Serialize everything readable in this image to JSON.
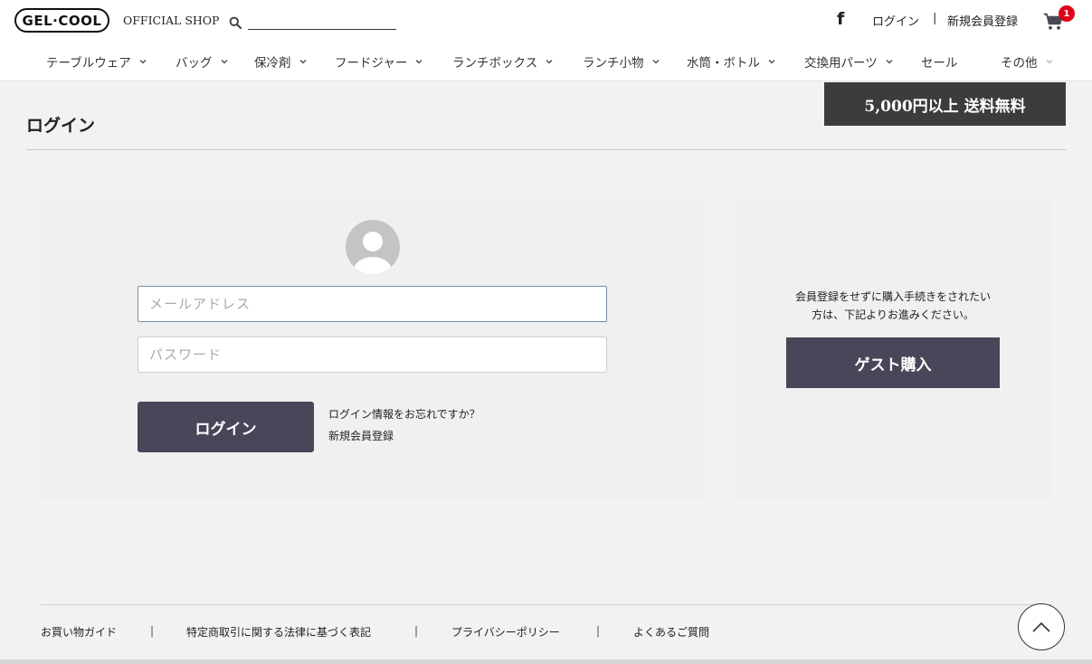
{
  "header": {
    "logo_text": "GEL·COOL",
    "shop_label": "OFFICIAL SHOP",
    "search_value": "",
    "login_link": "ログイン",
    "separator": "|",
    "register_link": "新規会員登録",
    "cart_count": "1",
    "icons": {
      "search": "search-icon",
      "facebook": "facebook-icon",
      "cart": "cart-icon"
    },
    "badge_color": "#e1001a"
  },
  "nav": {
    "items": [
      {
        "label": "テーブルウェア",
        "has_dropdown": true
      },
      {
        "label": "バッグ",
        "has_dropdown": true
      },
      {
        "label": "保冷剤",
        "has_dropdown": true
      },
      {
        "label": "フードジャー",
        "has_dropdown": true
      },
      {
        "label": "ランチボックス",
        "has_dropdown": true
      },
      {
        "label": "ランチ小物",
        "has_dropdown": true
      },
      {
        "label": "水筒・ボトル",
        "has_dropdown": true
      },
      {
        "label": "交換用パーツ",
        "has_dropdown": true
      },
      {
        "label": "セール",
        "has_dropdown": false
      },
      {
        "label": "その他",
        "has_dropdown": true
      }
    ]
  },
  "promo": {
    "text": "5,000円以上 送料無料"
  },
  "page": {
    "title": "ログイン"
  },
  "login": {
    "email_placeholder": "メールアドレス",
    "email_value": "",
    "password_placeholder": "パスワード",
    "password_value": "",
    "submit_label": "ログイン",
    "forgot_link": "ログイン情報をお忘れですか？",
    "register_link": "新規会員登録",
    "button_color": "#484658"
  },
  "guest": {
    "text_line1": "会員登録をせずに購入手続きをされたい",
    "text_line2": "方は、下記よりお進みください。",
    "button_label": "ゲスト購入"
  },
  "footer": {
    "links": [
      "お買い物ガイド",
      "特定商取引に関する法律に基づく表記",
      "プライバシーポリシー",
      "よくあるご質問"
    ],
    "separator": "|"
  }
}
